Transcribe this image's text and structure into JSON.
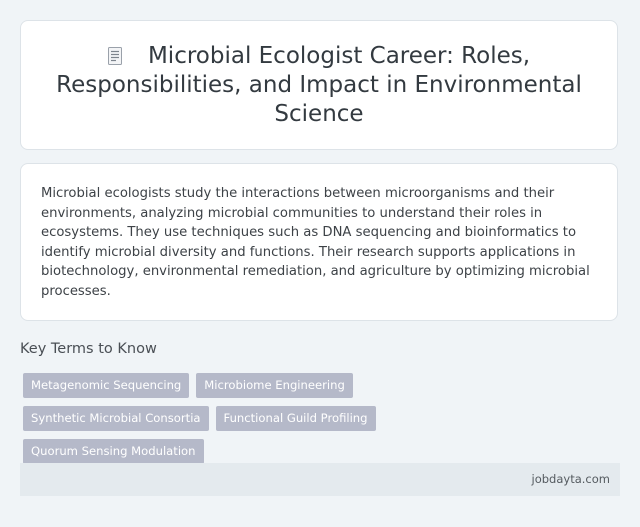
{
  "header": {
    "icon": "document-icon",
    "title": "Microbial Ecologist Career: Roles, Responsibilities, and Impact in Environmental Science"
  },
  "summary": {
    "text": "Microbial ecologists study the interactions between microorganisms and their environments, analyzing microbial communities to understand their roles in ecosystems. They use techniques such as DNA sequencing and bioinformatics to identify microbial diversity and functions. Their research supports applications in biotechnology, environmental remediation, and agriculture by optimizing microbial processes."
  },
  "key_terms": {
    "heading": "Key Terms to Know",
    "tags": [
      "Metagenomic Sequencing",
      "Microbiome Engineering",
      "Synthetic Microbial Consortia",
      "Functional Guild Profiling",
      "Quorum Sensing Modulation"
    ]
  },
  "footer": {
    "site": "jobdayta.com"
  },
  "colors": {
    "background": "#f0f4f7",
    "card": "#ffffff",
    "tag": "#b5b9c9",
    "footer": "#e4eaee"
  }
}
